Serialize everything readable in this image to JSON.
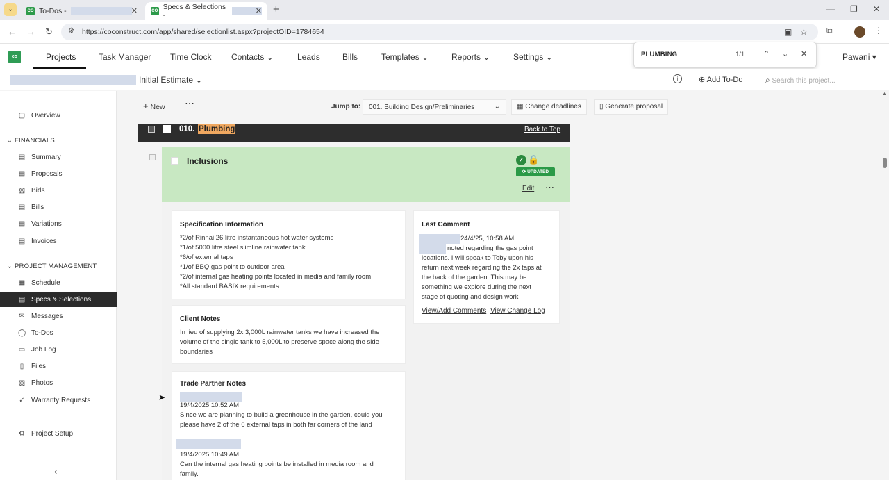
{
  "browser": {
    "tabs": [
      {
        "title": "To-Dos -"
      },
      {
        "title": "Specs & Selections -"
      }
    ],
    "url": "https://coconstruct.com/app/shared/selectionlist.aspx?projectOID=1784654"
  },
  "app": {
    "logo": "co",
    "nav": [
      "Projects",
      "Task Manager",
      "Time Clock",
      "Contacts",
      "Leads",
      "Bills",
      "Templates",
      "Reports",
      "Settings"
    ],
    "user": "Pawani"
  },
  "find": {
    "query": "PLUMBING",
    "count": "1/1"
  },
  "subheader": {
    "estimate": "Initial Estimate",
    "add_todo": "Add To-Do",
    "search_placeholder": "Search this project..."
  },
  "sidebar": {
    "overview": "Overview",
    "financials_title": "FINANCIALS",
    "financials": [
      "Summary",
      "Proposals",
      "Bids",
      "Bills",
      "Variations",
      "Invoices"
    ],
    "pm_title": "PROJECT MANAGEMENT",
    "pm": [
      "Schedule",
      "Specs & Selections",
      "Messages",
      "To-Dos",
      "Job Log",
      "Files",
      "Photos",
      "Warranty Requests"
    ],
    "setup": "Project Setup"
  },
  "toolbar": {
    "new": "New",
    "jump_label": "Jump to:",
    "jump_value": "001. Building Design/Preliminaries",
    "change_deadlines": "Change deadlines",
    "generate_proposal": "Generate proposal"
  },
  "category": {
    "number": "010.",
    "name": "Plumbing",
    "back_to_top": "Back to Top"
  },
  "item": {
    "title": "Inclusions",
    "badge": "UPDATED",
    "edit": "Edit",
    "spec_title": "Specification Information",
    "spec_lines": [
      "*2/of Rinnai 26 litre instantaneous hot water systems",
      "*1/of 5000 litre steel slimline rainwater tank",
      "*6/of external taps",
      "*1/of BBQ gas point to outdoor area",
      "*2/of internal gas heating points located in media and family room",
      "*All standard BASIX requirements"
    ],
    "client_title": "Client Notes",
    "client_lines": [
      "In lieu of supplying 2x 3,000L rainwater tanks we have increased the",
      "volume of the single tank to 5,000L to preserve space along the side",
      "boundaries"
    ],
    "trade_title": "Trade Partner Notes",
    "trade_notes": [
      {
        "date": "19/4/2025 10:52 AM",
        "lines": [
          "Since we are planning to build a greenhouse in the garden, could you",
          "please have 2 of the 6 external taps in both far corners of the land"
        ]
      },
      {
        "date": "19/4/2025 10:49 AM",
        "lines": [
          "Can the internal gas heating points be installed in media room and",
          "family."
        ]
      }
    ],
    "last_comment_title": "Last Comment",
    "comment_date": "24/4/25, 10:58 AM",
    "comment_lines": [
      "noted regarding the gas point",
      "locations. I will speak to Toby upon his",
      "return next week regarding the 2x taps at",
      "the back of the garden. This may be",
      "something we explore during the next",
      "stage of quoting and design work"
    ],
    "view_comments": "View/Add Comments",
    "view_log": "View Change Log"
  },
  "colors": {
    "accent": "#2f9c55",
    "panel": "#c8e8c2",
    "highlight": "#f0a860",
    "active": "#2b2b2b"
  }
}
